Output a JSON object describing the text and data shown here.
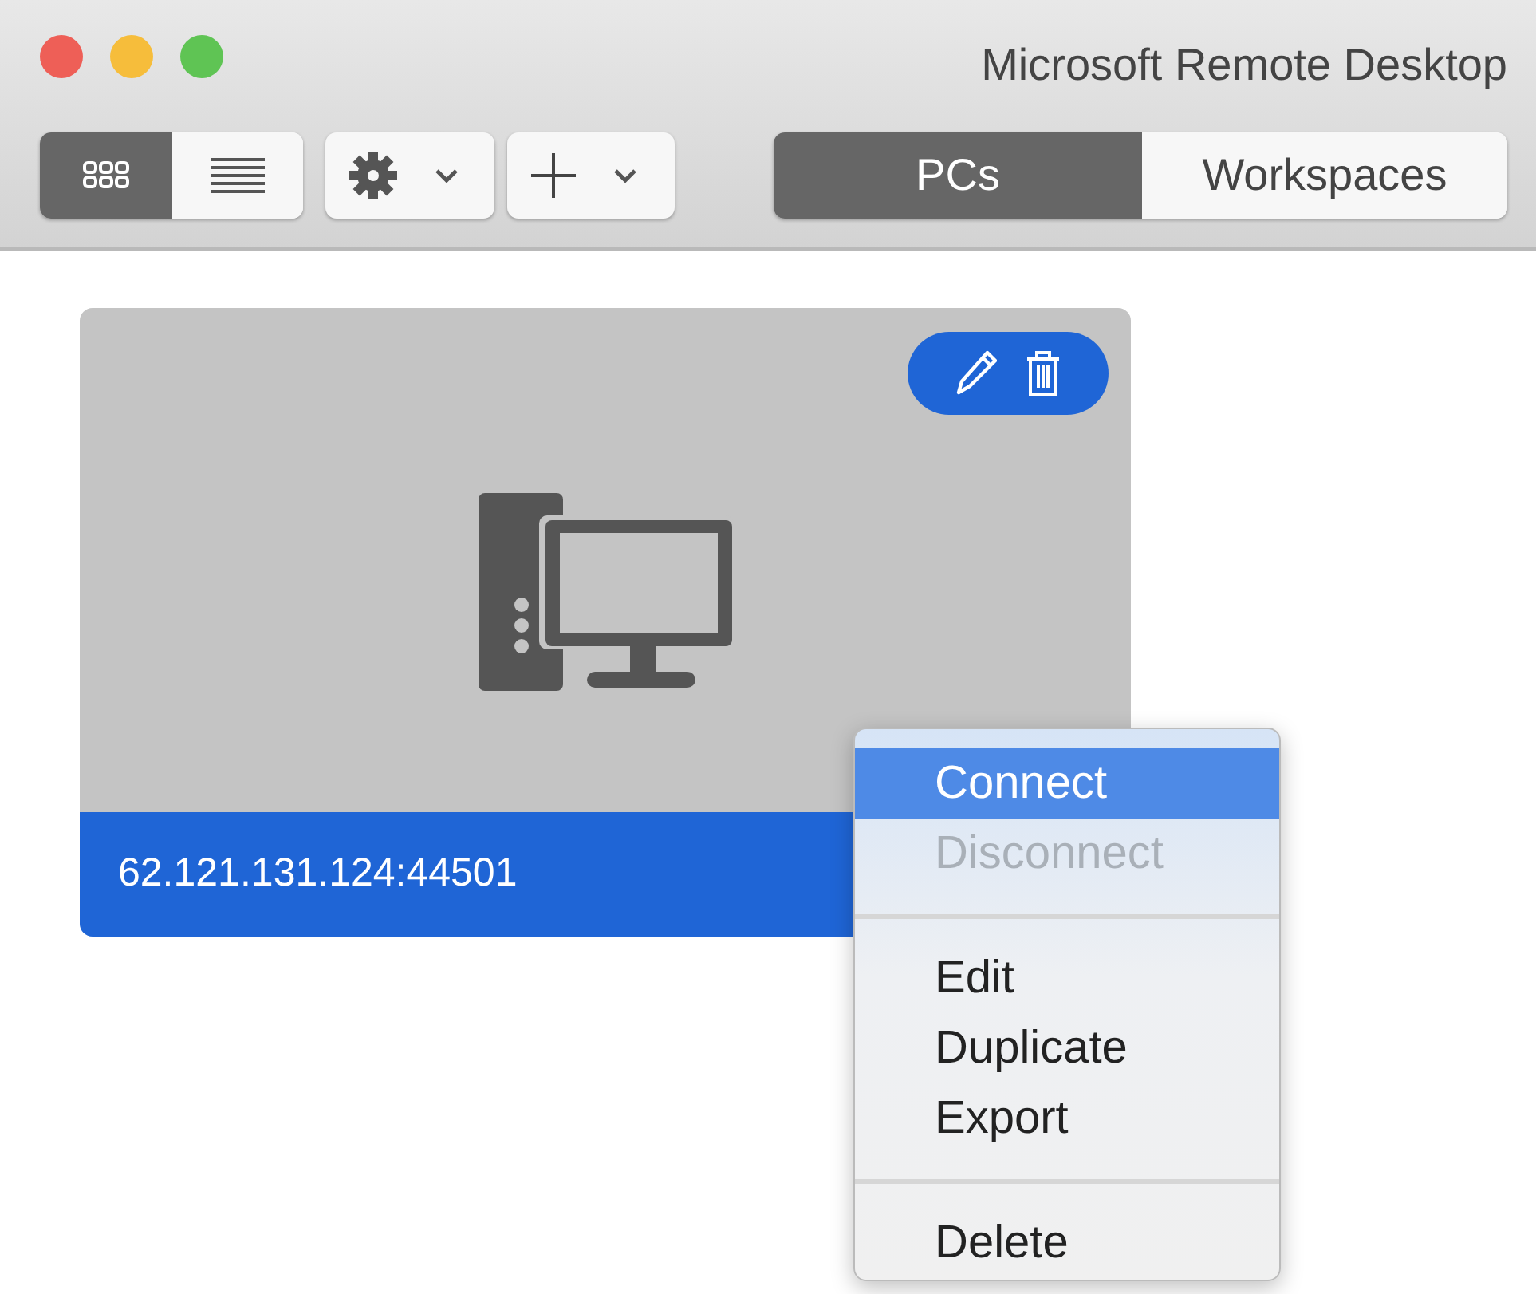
{
  "window": {
    "title": "Microsoft Remote Desktop"
  },
  "view_modes": [
    {
      "kind": "grid",
      "selected": true
    },
    {
      "kind": "list",
      "selected": false
    }
  ],
  "toolbar_buttons": [
    {
      "kind": "settings"
    },
    {
      "kind": "add"
    }
  ],
  "tabs": [
    {
      "label": "PCs",
      "selected": true
    },
    {
      "label": "Workspaces",
      "selected": false
    }
  ],
  "pcs": [
    {
      "label": "62.121.131.124:44501",
      "selected": true
    }
  ],
  "context_menu": [
    {
      "kind": "item",
      "label": "Connect",
      "highlighted": true,
      "disabled": false
    },
    {
      "kind": "item",
      "label": "Disconnect",
      "highlighted": false,
      "disabled": true
    },
    {
      "kind": "separator"
    },
    {
      "kind": "item",
      "label": "Edit",
      "highlighted": false,
      "disabled": false
    },
    {
      "kind": "item",
      "label": "Duplicate",
      "highlighted": false,
      "disabled": false
    },
    {
      "kind": "item",
      "label": "Export",
      "highlighted": false,
      "disabled": false
    },
    {
      "kind": "separator"
    },
    {
      "kind": "item",
      "label": "Delete",
      "highlighted": false,
      "disabled": false
    }
  ]
}
